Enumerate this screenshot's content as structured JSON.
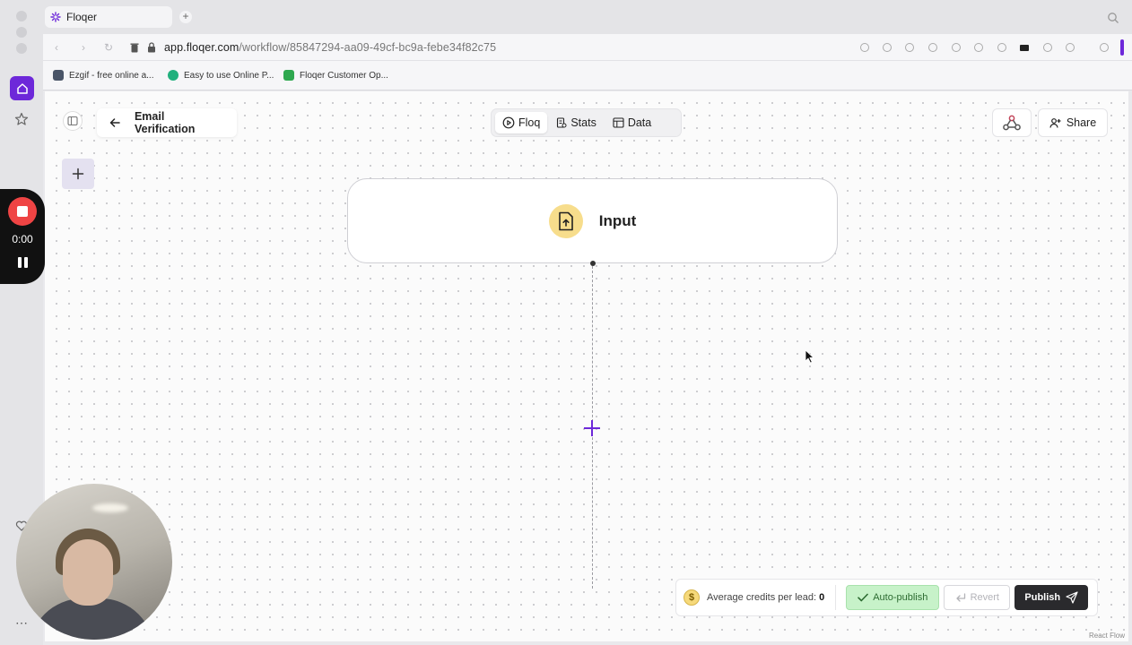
{
  "browser": {
    "tab_title": "Floqer",
    "url_domain": "app.floqer.com",
    "url_path": "/workflow/85847294-aa09-49cf-bc9a-febe34f82c75",
    "bookmarks": [
      {
        "label": "Ezgif - free online a...",
        "color": "#4a5568"
      },
      {
        "label": "Easy to use Online P...",
        "color": "#22b07d"
      },
      {
        "label": "Floqer Customer Op...",
        "color": "#2fa84f"
      }
    ]
  },
  "recording": {
    "time": "0:00"
  },
  "workflow": {
    "title": "Email Verification",
    "tabs": [
      {
        "label": "Floq",
        "icon": "play-circle-icon",
        "active": true
      },
      {
        "label": "Stats",
        "icon": "stats-icon",
        "active": false
      },
      {
        "label": "Data",
        "icon": "table-icon",
        "active": false
      }
    ],
    "share_label": "Share",
    "node": {
      "label": "Input",
      "icon": "file-upload-icon",
      "icon_bg": "#f7dd8c"
    }
  },
  "footer": {
    "credits_label": "Average credits per lead:",
    "credits_value": "0",
    "auto_publish_label": "Auto-publish",
    "revert_label": "Revert",
    "publish_label": "Publish"
  },
  "attribution": "React Flow",
  "colors": {
    "accent": "#6d28d9",
    "record": "#ef4444",
    "publish_bg": "#2a2a2d",
    "autopub_bg": "#c7f2c9"
  }
}
